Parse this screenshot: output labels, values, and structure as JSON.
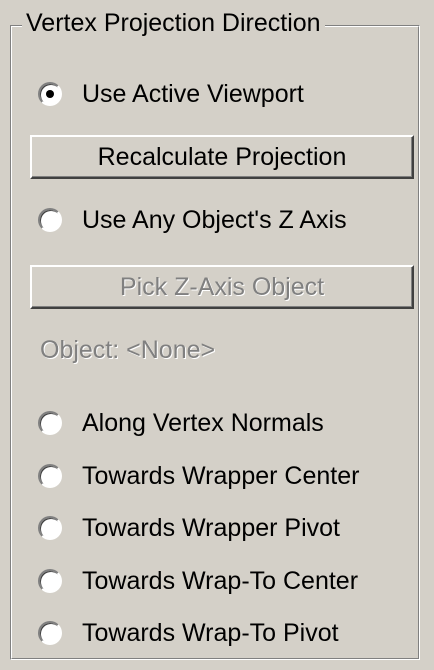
{
  "group": {
    "title": "Vertex Projection Direction"
  },
  "options": {
    "use_active_viewport": {
      "label": "Use Active Viewport",
      "selected": true
    },
    "use_any_object_z_axis": {
      "label": "Use Any Object's Z Axis",
      "selected": false
    },
    "along_vertex_normals": {
      "label": "Along Vertex Normals",
      "selected": false
    },
    "towards_wrapper_center": {
      "label": "Towards Wrapper Center",
      "selected": false
    },
    "towards_wrapper_pivot": {
      "label": "Towards Wrapper Pivot",
      "selected": false
    },
    "towards_wrap_to_center": {
      "label": "Towards Wrap-To Center",
      "selected": false
    },
    "towards_wrap_to_pivot": {
      "label": "Towards Wrap-To Pivot",
      "selected": false
    }
  },
  "buttons": {
    "recalculate_projection": {
      "label": "Recalculate Projection",
      "enabled": true
    },
    "pick_z_axis_object": {
      "label": "Pick Z-Axis Object",
      "enabled": false
    }
  },
  "object_status": "Object: <None>",
  "colors": {
    "panel_bg": "#d4d0c8",
    "disabled_text": "#808080"
  }
}
